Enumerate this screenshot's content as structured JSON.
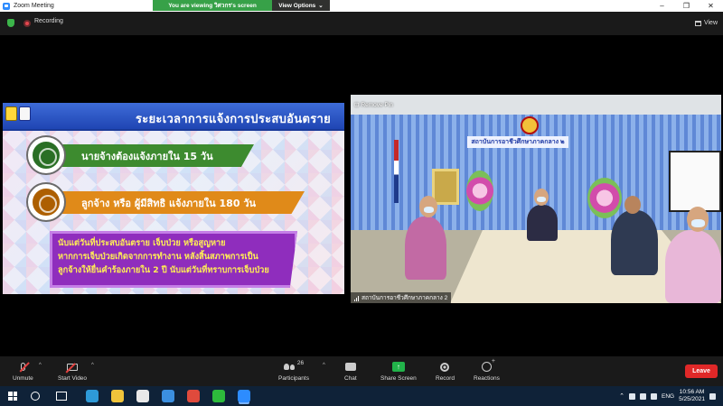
{
  "window": {
    "title": "Zoom Meeting",
    "minimize": "–",
    "maximize": "❐",
    "close": "✕"
  },
  "share_banner": {
    "message": "You are viewing วิศวกร's screen",
    "view_options": "View Options",
    "caret": "⌄"
  },
  "topbar": {
    "recording": "Recording",
    "view": "View"
  },
  "slide": {
    "title": "ระยะเวลาการแจ้งการประสบอันตราย",
    "bar1": "นายจ้างต้องแจ้งภายใน 15 วัน",
    "bar2": "ลูกจ้าง หรือ ผู้มีสิทธิ แจ้งภายใน 180 วัน",
    "note_lines": [
      "นับแต่วันที่ประสบอันตราย เจ็บป่วย หรือสูญหาย",
      "หากการเจ็บป่วยเกิดจากการทำงาน หลังสิ้นสภาพการเป็น",
      "ลูกจ้างให้ยื่นคำร้องภายใน 2 ปี นับแต่วันที่ทราบการเจ็บป่วย"
    ]
  },
  "video": {
    "remove_pin": "Remove Pin",
    "participant_name": "สถาบันการอาชีวศึกษาภาคกลาง 2",
    "banner_text": "สถาบันการอาชีวศึกษาภาคกลาง ๒"
  },
  "toolbar": {
    "unmute": "Unmute",
    "start_video": "Start Video",
    "participants": "Participants",
    "participant_count": "26",
    "chat": "Chat",
    "share_screen": "Share Screen",
    "record": "Record",
    "reactions": "Reactions",
    "leave": "Leave",
    "caret": "^"
  },
  "taskbar": {
    "language": "ENG",
    "time": "10:56 AM",
    "date": "5/25/2021",
    "apps": [
      {
        "name": "edge-icon",
        "color": "#2e9ad8"
      },
      {
        "name": "file-explorer-icon",
        "color": "#f0c43b"
      },
      {
        "name": "store-icon",
        "color": "#e8e8e8"
      },
      {
        "name": "mail-icon",
        "color": "#3b8fe0"
      },
      {
        "name": "chrome-icon",
        "color": "#e04a3c"
      },
      {
        "name": "line-icon",
        "color": "#2dbb3c"
      },
      {
        "name": "zoom-icon",
        "color": "#2d8cff"
      }
    ]
  },
  "colors": {
    "share_green": "#37a148",
    "leave_red": "#e02828",
    "toolbar_bg": "#1a1a1a",
    "taskbar_bg": "#0f2238"
  }
}
